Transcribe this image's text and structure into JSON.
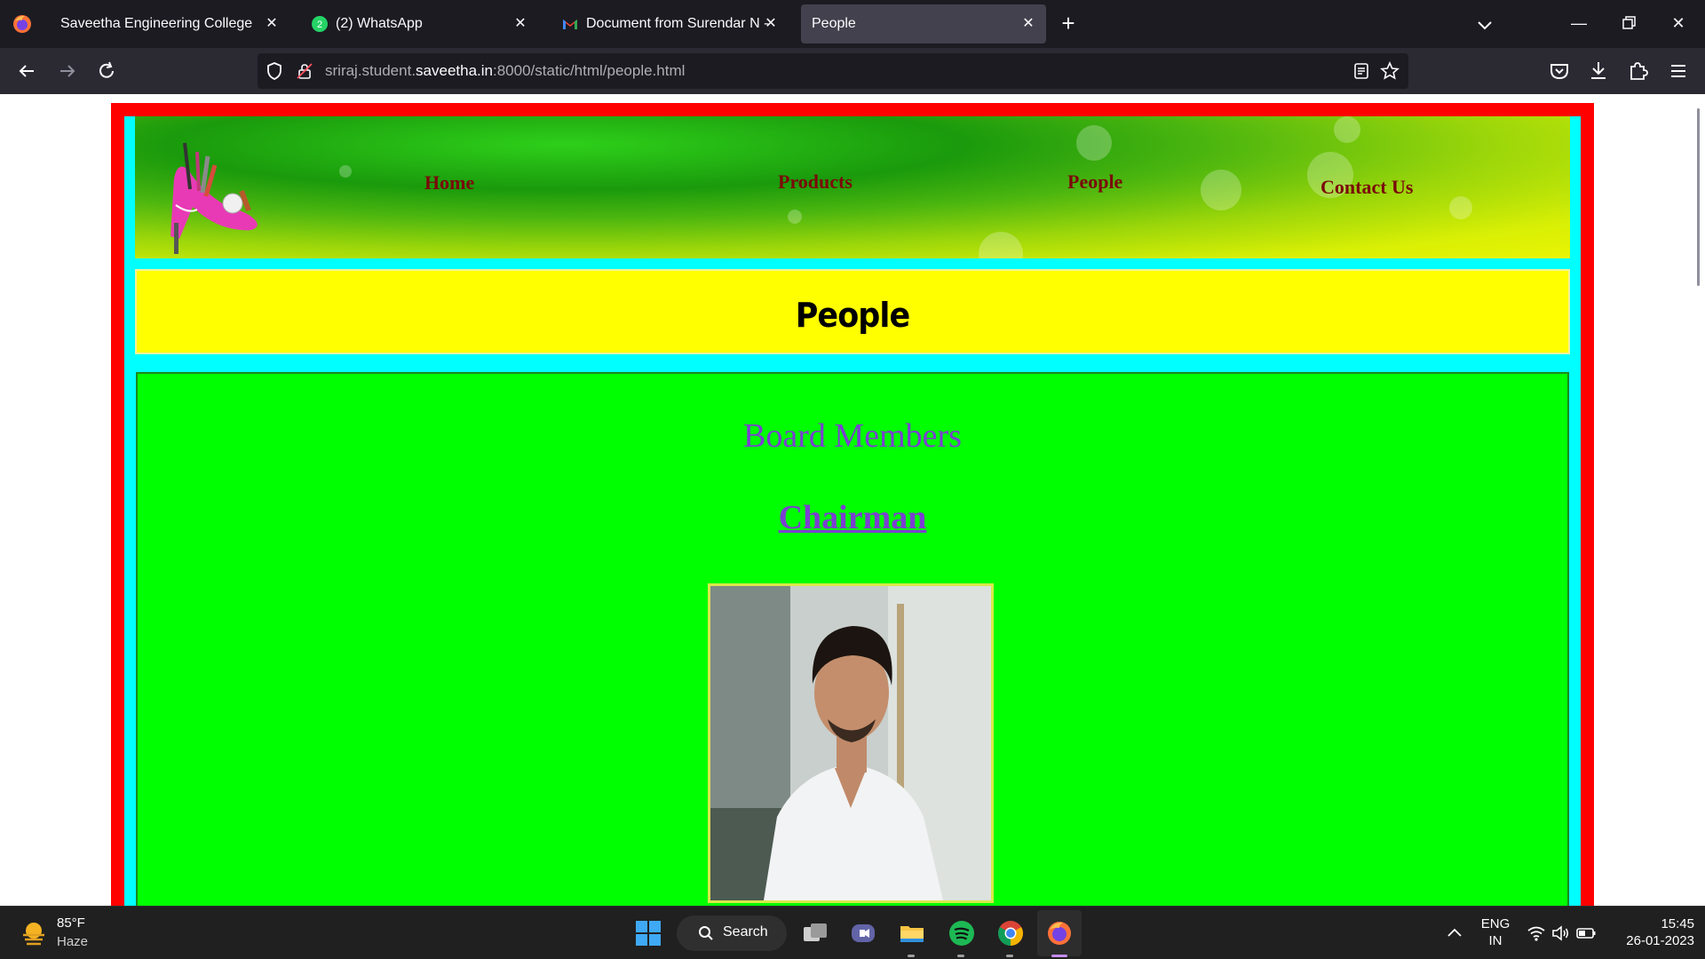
{
  "browser": {
    "tabs": [
      {
        "title": "Saveetha Engineering College",
        "icon": "college-favicon"
      },
      {
        "title": "(2) WhatsApp",
        "icon": "whatsapp-icon",
        "badge": "2"
      },
      {
        "title": "Document from Surendar N - sr",
        "icon": "gmail-icon"
      },
      {
        "title": "People",
        "icon": "none",
        "active": true
      }
    ],
    "url": {
      "prefix": "sriraj.student.",
      "host": "saveetha.in",
      "suffix": ":8000/static/html/people.html"
    }
  },
  "site": {
    "nav": [
      "Home",
      "Products",
      "People",
      "Contact Us"
    ],
    "page_title": "People",
    "section_title": "Board Members",
    "role_title": "Chairman"
  },
  "taskbar": {
    "weather": {
      "temp": "85°F",
      "desc": "Haze"
    },
    "search_label": "Search",
    "lang_top": "ENG",
    "lang_bottom": "IN",
    "time": "15:45",
    "date": "26-01-2023"
  },
  "colors": {
    "frame_red": "#ff0000",
    "frame_cyan": "#00ffff",
    "title_yellow": "#ffff00",
    "content_green": "#00ff00",
    "heading_purple": "#7b3fd1",
    "nav_maroon": "#7a0a0a"
  }
}
